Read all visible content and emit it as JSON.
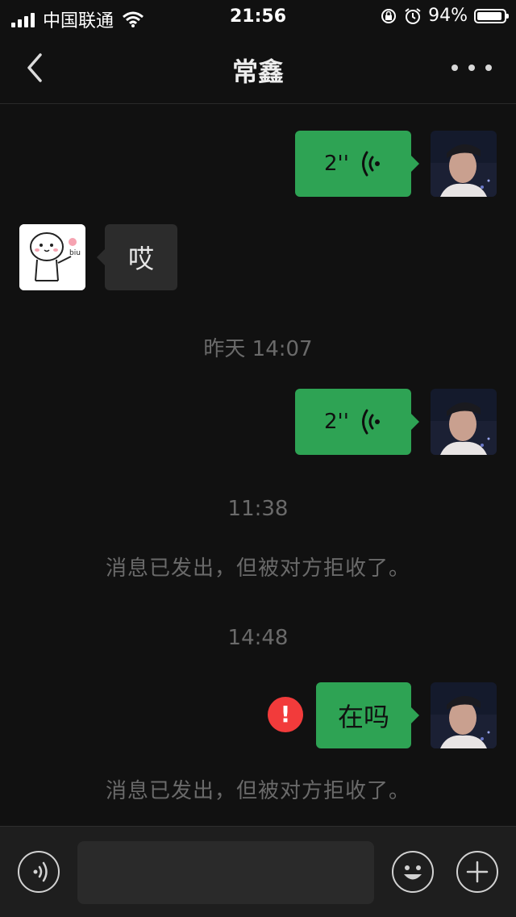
{
  "status_bar": {
    "carrier": "中国联通",
    "time": "21:56",
    "battery": "94%",
    "battery_level": 0.94
  },
  "navbar": {
    "title": "常鑫",
    "back_icon": "chevron-left-icon",
    "more_icon": "more-dots-icon"
  },
  "messages": [
    {
      "type": "voice",
      "direction": "outgoing",
      "duration": "2''"
    },
    {
      "type": "text",
      "direction": "incoming",
      "text": "哎"
    },
    {
      "type": "timestamp",
      "text": "昨天 14:07"
    },
    {
      "type": "voice",
      "direction": "outgoing",
      "duration": "2''"
    },
    {
      "type": "timestamp",
      "text": "11:38"
    },
    {
      "type": "system",
      "text": "消息已发出，但被对方拒收了。"
    },
    {
      "type": "timestamp",
      "text": "14:48"
    },
    {
      "type": "text",
      "direction": "outgoing",
      "text": "在吗",
      "failed": true,
      "error_mark": "!"
    },
    {
      "type": "system",
      "text": "消息已发出，但被对方拒收了。"
    }
  ],
  "input_bar": {
    "voice_icon": "voice-input-icon",
    "emoji_icon": "emoji-icon",
    "add_icon": "plus-icon",
    "placeholder": ""
  },
  "colors": {
    "outgoing_bubble": "#2ea354",
    "incoming_bubble": "#2c2c2c",
    "error": "#f23b3b",
    "background": "#111111"
  }
}
